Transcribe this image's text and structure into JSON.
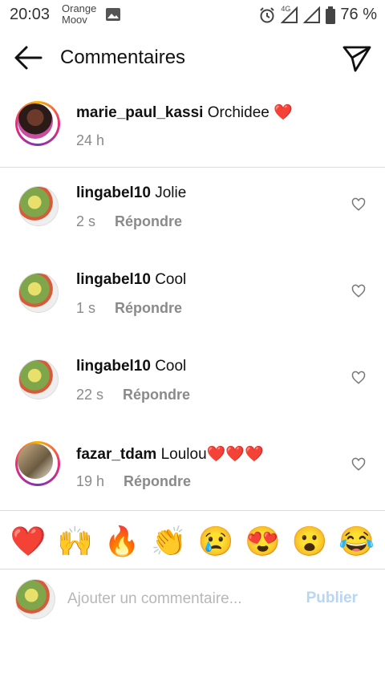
{
  "status_bar": {
    "time": "20:03",
    "carrier_line1": "Orange",
    "carrier_line2": "Moov",
    "network": "4G",
    "battery": "76 %"
  },
  "header": {
    "title": "Commentaires",
    "back_icon": "back-arrow-icon",
    "send_icon": "send-paper-plane-icon"
  },
  "caption": {
    "username": "marie_paul_kassi",
    "text": " Orchidee ❤️",
    "time": "24 h"
  },
  "comments": [
    {
      "username": "lingabel10",
      "text": " Jolie",
      "time": "2 s",
      "reply": "Répondre"
    },
    {
      "username": "lingabel10",
      "text": " Cool",
      "time": "1 s",
      "reply": "Répondre"
    },
    {
      "username": "lingabel10",
      "text": " Cool",
      "time": "22 s",
      "reply": "Répondre"
    },
    {
      "username": "fazar_tdam",
      "text": " Loulou❤️❤️❤️",
      "time": "19 h",
      "reply": "Répondre"
    }
  ],
  "emoji_bar": [
    "❤️",
    "🙌",
    "🔥",
    "👏",
    "😢",
    "😍",
    "😮",
    "😂"
  ],
  "input": {
    "placeholder": "Ajouter un commentaire...",
    "publish_label": "Publier"
  },
  "colors": {
    "link_disabled": "#b7d6f4",
    "muted_text": "#8a8a8a",
    "story_ring_start": "#f7b500",
    "story_ring_end": "#8134af"
  }
}
